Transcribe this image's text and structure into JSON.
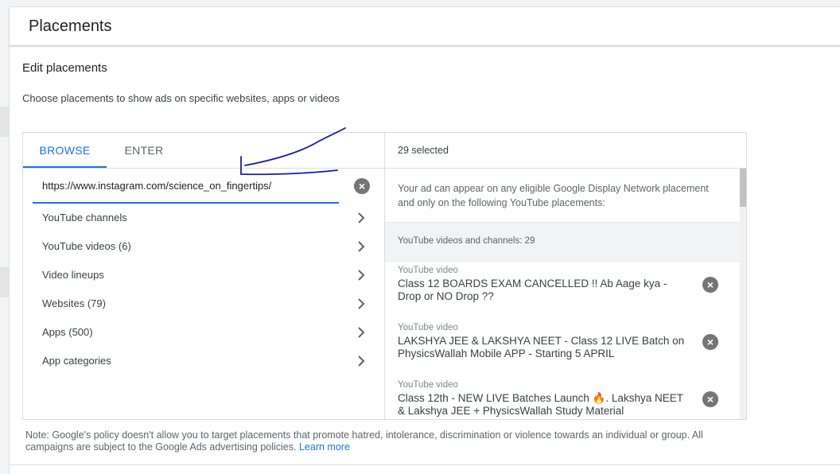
{
  "header": {
    "title": "Placements"
  },
  "section": {
    "title": "Edit placements",
    "description": "Choose placements to show ads on specific websites, apps or videos"
  },
  "tabs": {
    "browse": "BROWSE",
    "enter": "ENTER"
  },
  "search": {
    "value": "https://www.instagram.com/science_on_fingertips/",
    "clear_icon": "close-circle-icon"
  },
  "categories": [
    {
      "label": "YouTube channels"
    },
    {
      "label": "YouTube videos (6)"
    },
    {
      "label": "Video lineups"
    },
    {
      "label": "Websites (79)"
    },
    {
      "label": "Apps (500)"
    },
    {
      "label": "App categories"
    }
  ],
  "selected": {
    "count_label": "29 selected",
    "info": "Your ad can appear on any eligible Google Display Network placement and only on the following YouTube placements:",
    "group_label": "YouTube videos and channels: 29",
    "items": [
      {
        "type": "YouTube video",
        "title": "Class 12 BOARDS EXAM CANCELLED !! Ab Aage kya - Drop or NO Drop ??"
      },
      {
        "type": "YouTube video",
        "title": "LAKSHYA JEE & LAKSHYA NEET - Class 12 LIVE Batch on PhysicsWallah Mobile APP - Starting 5 APRIL"
      },
      {
        "type": "YouTube video",
        "title": "Class 12th - NEW LIVE Batches Launch 🔥. Lakshya NEET & Lakshya JEE + PhysicsWallah Study Material"
      }
    ]
  },
  "note": {
    "text": "Note: Google's policy doesn't allow you to target placements that promote hatred, intolerance, discrimination or violence towards an individual or group. All campaigns are subject to the Google Ads advertising policies.",
    "link": "Learn more"
  },
  "colors": {
    "accent": "#1a73e8",
    "annotation_ink": "#1a1aa8"
  }
}
